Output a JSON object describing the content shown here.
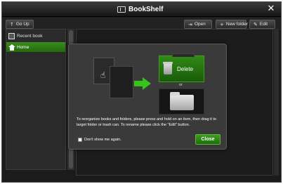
{
  "window": {
    "title": "BookShelf",
    "close_label": "✕"
  },
  "toolbar": {
    "go_up_label": "Go Up",
    "open_label": "Open",
    "new_folder_label": "New folder",
    "edit_label": "Edit"
  },
  "sidebar": {
    "items": [
      {
        "label": "Recent book",
        "icon": "recent-book-icon"
      },
      {
        "label": "Home",
        "icon": "home-icon",
        "selected": true
      }
    ]
  },
  "dialog": {
    "delete_label": "Delete",
    "or_label": "or",
    "instructions": "To reorganize books and folders, please press and hold on an item, then drag it to target folder or trash can. To rename please click the \"Edit\" button.",
    "checkbox_label": "Don't show me again.",
    "checkbox_checked": false,
    "close_label": "Close"
  },
  "colors": {
    "accent_green": "#2e8a16",
    "background": "#1b1b1b"
  }
}
